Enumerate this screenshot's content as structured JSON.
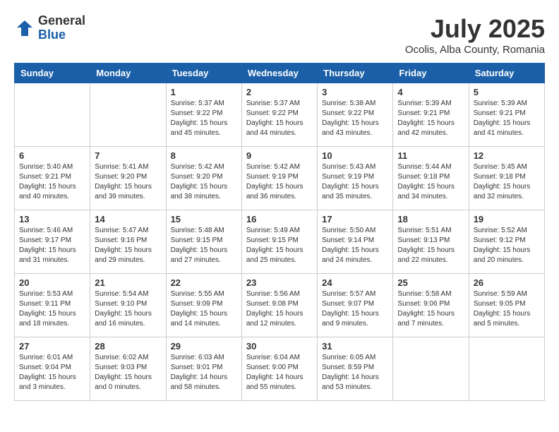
{
  "header": {
    "logo": {
      "general": "General",
      "blue": "Blue"
    },
    "title": "July 2025",
    "location": "Ocolis, Alba County, Romania"
  },
  "calendar": {
    "days_of_week": [
      "Sunday",
      "Monday",
      "Tuesday",
      "Wednesday",
      "Thursday",
      "Friday",
      "Saturday"
    ],
    "weeks": [
      [
        {
          "day": "",
          "info": ""
        },
        {
          "day": "",
          "info": ""
        },
        {
          "day": "1",
          "info": "Sunrise: 5:37 AM\nSunset: 9:22 PM\nDaylight: 15 hours\nand 45 minutes."
        },
        {
          "day": "2",
          "info": "Sunrise: 5:37 AM\nSunset: 9:22 PM\nDaylight: 15 hours\nand 44 minutes."
        },
        {
          "day": "3",
          "info": "Sunrise: 5:38 AM\nSunset: 9:22 PM\nDaylight: 15 hours\nand 43 minutes."
        },
        {
          "day": "4",
          "info": "Sunrise: 5:39 AM\nSunset: 9:21 PM\nDaylight: 15 hours\nand 42 minutes."
        },
        {
          "day": "5",
          "info": "Sunrise: 5:39 AM\nSunset: 9:21 PM\nDaylight: 15 hours\nand 41 minutes."
        }
      ],
      [
        {
          "day": "6",
          "info": "Sunrise: 5:40 AM\nSunset: 9:21 PM\nDaylight: 15 hours\nand 40 minutes."
        },
        {
          "day": "7",
          "info": "Sunrise: 5:41 AM\nSunset: 9:20 PM\nDaylight: 15 hours\nand 39 minutes."
        },
        {
          "day": "8",
          "info": "Sunrise: 5:42 AM\nSunset: 9:20 PM\nDaylight: 15 hours\nand 38 minutes."
        },
        {
          "day": "9",
          "info": "Sunrise: 5:42 AM\nSunset: 9:19 PM\nDaylight: 15 hours\nand 36 minutes."
        },
        {
          "day": "10",
          "info": "Sunrise: 5:43 AM\nSunset: 9:19 PM\nDaylight: 15 hours\nand 35 minutes."
        },
        {
          "day": "11",
          "info": "Sunrise: 5:44 AM\nSunset: 9:18 PM\nDaylight: 15 hours\nand 34 minutes."
        },
        {
          "day": "12",
          "info": "Sunrise: 5:45 AM\nSunset: 9:18 PM\nDaylight: 15 hours\nand 32 minutes."
        }
      ],
      [
        {
          "day": "13",
          "info": "Sunrise: 5:46 AM\nSunset: 9:17 PM\nDaylight: 15 hours\nand 31 minutes."
        },
        {
          "day": "14",
          "info": "Sunrise: 5:47 AM\nSunset: 9:16 PM\nDaylight: 15 hours\nand 29 minutes."
        },
        {
          "day": "15",
          "info": "Sunrise: 5:48 AM\nSunset: 9:15 PM\nDaylight: 15 hours\nand 27 minutes."
        },
        {
          "day": "16",
          "info": "Sunrise: 5:49 AM\nSunset: 9:15 PM\nDaylight: 15 hours\nand 25 minutes."
        },
        {
          "day": "17",
          "info": "Sunrise: 5:50 AM\nSunset: 9:14 PM\nDaylight: 15 hours\nand 24 minutes."
        },
        {
          "day": "18",
          "info": "Sunrise: 5:51 AM\nSunset: 9:13 PM\nDaylight: 15 hours\nand 22 minutes."
        },
        {
          "day": "19",
          "info": "Sunrise: 5:52 AM\nSunset: 9:12 PM\nDaylight: 15 hours\nand 20 minutes."
        }
      ],
      [
        {
          "day": "20",
          "info": "Sunrise: 5:53 AM\nSunset: 9:11 PM\nDaylight: 15 hours\nand 18 minutes."
        },
        {
          "day": "21",
          "info": "Sunrise: 5:54 AM\nSunset: 9:10 PM\nDaylight: 15 hours\nand 16 minutes."
        },
        {
          "day": "22",
          "info": "Sunrise: 5:55 AM\nSunset: 9:09 PM\nDaylight: 15 hours\nand 14 minutes."
        },
        {
          "day": "23",
          "info": "Sunrise: 5:56 AM\nSunset: 9:08 PM\nDaylight: 15 hours\nand 12 minutes."
        },
        {
          "day": "24",
          "info": "Sunrise: 5:57 AM\nSunset: 9:07 PM\nDaylight: 15 hours\nand 9 minutes."
        },
        {
          "day": "25",
          "info": "Sunrise: 5:58 AM\nSunset: 9:06 PM\nDaylight: 15 hours\nand 7 minutes."
        },
        {
          "day": "26",
          "info": "Sunrise: 5:59 AM\nSunset: 9:05 PM\nDaylight: 15 hours\nand 5 minutes."
        }
      ],
      [
        {
          "day": "27",
          "info": "Sunrise: 6:01 AM\nSunset: 9:04 PM\nDaylight: 15 hours\nand 3 minutes."
        },
        {
          "day": "28",
          "info": "Sunrise: 6:02 AM\nSunset: 9:03 PM\nDaylight: 15 hours\nand 0 minutes."
        },
        {
          "day": "29",
          "info": "Sunrise: 6:03 AM\nSunset: 9:01 PM\nDaylight: 14 hours\nand 58 minutes."
        },
        {
          "day": "30",
          "info": "Sunrise: 6:04 AM\nSunset: 9:00 PM\nDaylight: 14 hours\nand 55 minutes."
        },
        {
          "day": "31",
          "info": "Sunrise: 6:05 AM\nSunset: 8:59 PM\nDaylight: 14 hours\nand 53 minutes."
        },
        {
          "day": "",
          "info": ""
        },
        {
          "day": "",
          "info": ""
        }
      ]
    ]
  }
}
